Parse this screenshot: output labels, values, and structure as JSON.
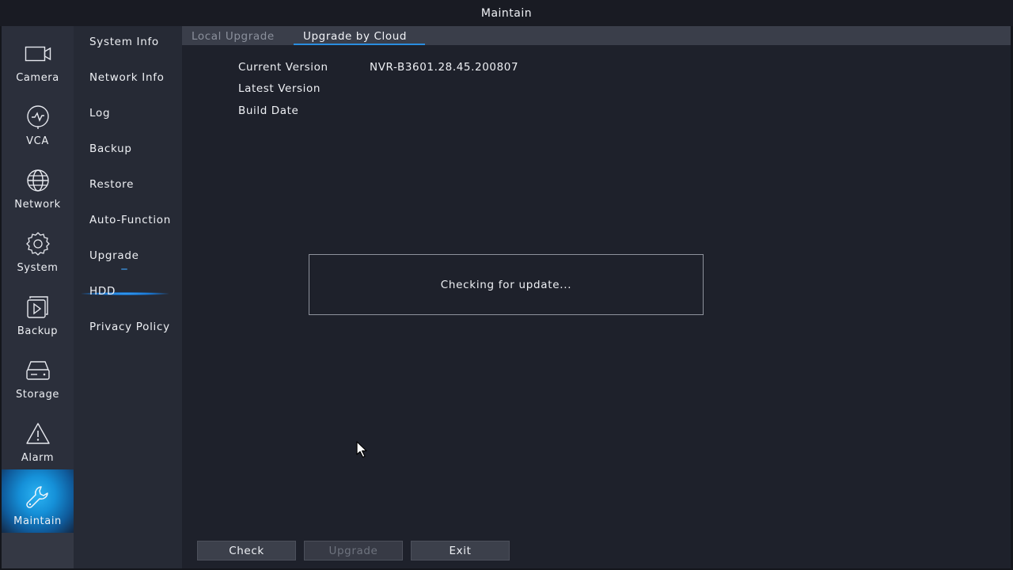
{
  "window": {
    "title": "Maintain"
  },
  "left_nav": {
    "items": [
      {
        "label": "Camera",
        "icon": "camera-icon"
      },
      {
        "label": "VCA",
        "icon": "vca-icon"
      },
      {
        "label": "Network",
        "icon": "globe-icon"
      },
      {
        "label": "System",
        "icon": "gear-icon"
      },
      {
        "label": "Backup",
        "icon": "backup-icon"
      },
      {
        "label": "Storage",
        "icon": "hdd-icon"
      },
      {
        "label": "Alarm",
        "icon": "warning-icon"
      },
      {
        "label": "Maintain",
        "icon": "wrench-icon",
        "active": true
      }
    ]
  },
  "sub_menu": {
    "items": [
      {
        "label": "System Info"
      },
      {
        "label": "Network Info"
      },
      {
        "label": "Log"
      },
      {
        "label": "Backup"
      },
      {
        "label": "Restore"
      },
      {
        "label": "Auto-Function"
      },
      {
        "label": "Upgrade",
        "active": true
      },
      {
        "label": "HDD"
      },
      {
        "label": "Privacy Policy"
      }
    ]
  },
  "tabs": {
    "local": "Local Upgrade",
    "cloud": "Upgrade by Cloud",
    "active": "Upgrade by Cloud"
  },
  "info": {
    "current_version_label": "Current Version",
    "current_version_value": "NVR-B3601.28.45.200807",
    "latest_version_label": "Latest Version",
    "latest_version_value": "",
    "build_date_label": "Build Date",
    "build_date_value": ""
  },
  "dialog": {
    "message": "Checking for update..."
  },
  "buttons": {
    "check": "Check",
    "upgrade": "Upgrade",
    "exit": "Exit"
  },
  "colors": {
    "accent": "#2a8de0",
    "active_nav": "#1590d8",
    "background": "#1e212b"
  }
}
